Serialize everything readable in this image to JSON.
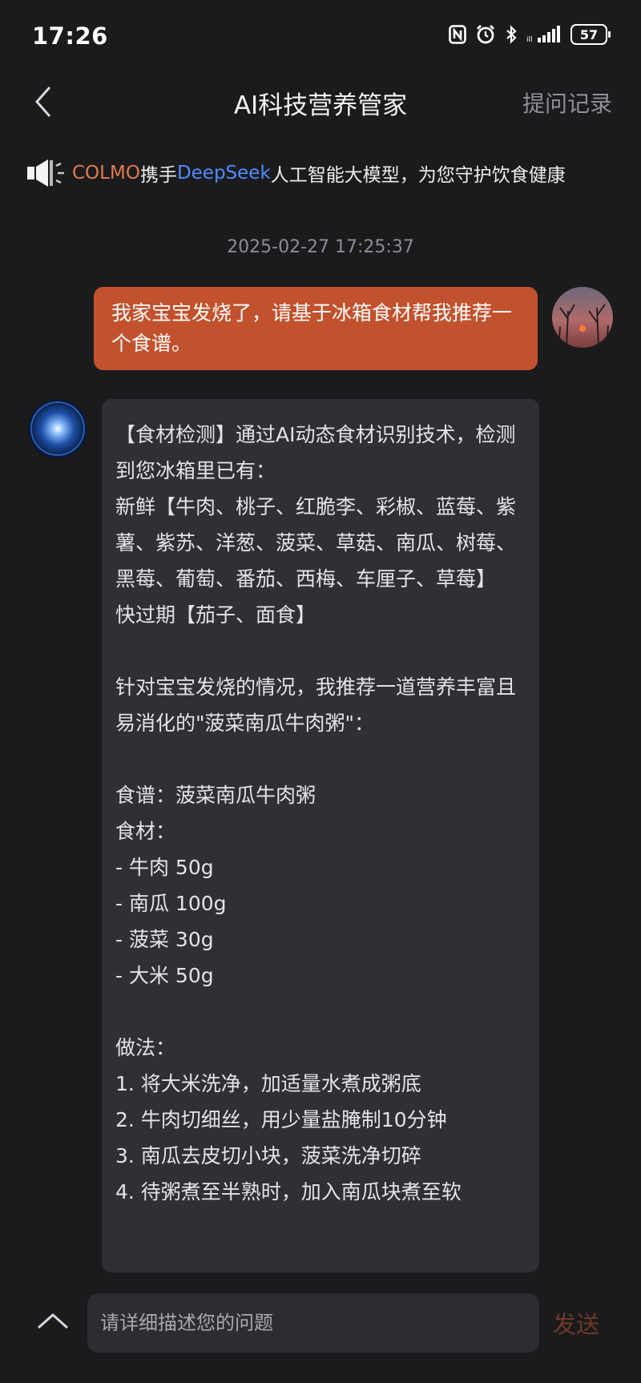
{
  "status_bar": {
    "time": "17:26",
    "battery": "57",
    "icons": [
      "nfc-icon",
      "alarm-icon",
      "bluetooth-icon",
      "signal-icon",
      "battery-icon"
    ]
  },
  "header": {
    "title": "AI科技营养管家",
    "history_label": "提问记录"
  },
  "banner": {
    "brand_a": "COLMO",
    "text_a": "携手",
    "brand_b": "DeepSeek",
    "text_b": "人工智能大模型，为您守护饮食健康"
  },
  "chat": {
    "timestamp": "2025-02-27 17:25:37",
    "user_message": "我家宝宝发烧了，请基于冰箱食材帮我推荐一个食谱。",
    "bot_message": "【食材检测】通过AI动态食材识别技术，检测到您冰箱里已有：\n新鲜【牛肉、桃子、红脆李、彩椒、蓝莓、紫薯、紫苏、洋葱、菠菜、草菇、南瓜、树莓、黑莓、葡萄、番茄、西梅、车厘子、草莓】\n快过期【茄子、面食】\n\n针对宝宝发烧的情况，我推荐一道营养丰富且易消化的\"菠菜南瓜牛肉粥\"：\n\n食谱：菠菜南瓜牛肉粥\n食材：\n- 牛肉 50g\n- 南瓜 100g\n- 菠菜 30g\n- 大米 50g\n\n做法：\n1. 将大米洗净，加适量水煮成粥底\n2. 牛肉切细丝，用少量盐腌制10分钟\n3. 南瓜去皮切小块，菠菜洗净切碎\n4. 待粥煮至半熟时，加入南瓜块煮至软"
  },
  "input": {
    "placeholder": "请详细描述您的问题",
    "send_label": "发送"
  },
  "colors": {
    "background": "#1b1b1d",
    "user_bubble": "#c2522d",
    "bot_bubble": "#2e3035",
    "brand_colmo": "#e07a4d",
    "brand_deepseek": "#4d8dff",
    "send_disabled": "#6d3a27"
  }
}
